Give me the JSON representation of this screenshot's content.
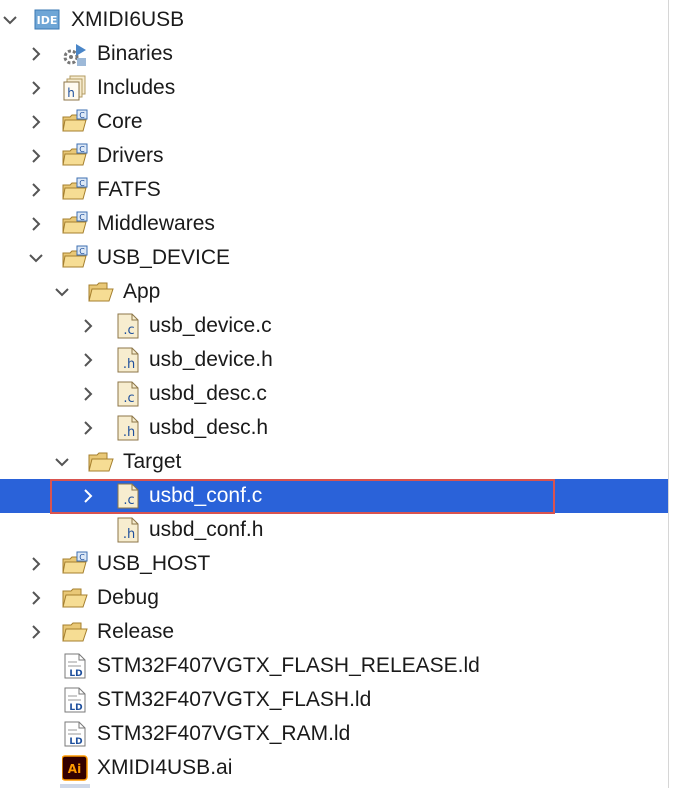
{
  "tree": {
    "rows": [
      {
        "label": "XMIDI6USB",
        "icon": "ide-project-icon",
        "chevron": "down"
      },
      {
        "label": "Binaries",
        "icon": "binaries-icon",
        "chevron": "right"
      },
      {
        "label": "Includes",
        "icon": "includes-icon",
        "chevron": "right"
      },
      {
        "label": "Core",
        "icon": "source-folder-icon",
        "chevron": "right"
      },
      {
        "label": "Drivers",
        "icon": "source-folder-icon",
        "chevron": "right"
      },
      {
        "label": "FATFS",
        "icon": "source-folder-icon",
        "chevron": "right"
      },
      {
        "label": "Middlewares",
        "icon": "source-folder-icon",
        "chevron": "right"
      },
      {
        "label": "USB_DEVICE",
        "icon": "source-folder-icon",
        "chevron": "down"
      },
      {
        "label": "App",
        "icon": "folder-open-icon",
        "chevron": "down"
      },
      {
        "label": "usb_device.c",
        "icon": "c-file-icon",
        "chevron": "right"
      },
      {
        "label": "usb_device.h",
        "icon": "h-file-icon",
        "chevron": "right"
      },
      {
        "label": "usbd_desc.c",
        "icon": "c-file-icon",
        "chevron": "right"
      },
      {
        "label": "usbd_desc.h",
        "icon": "h-file-icon",
        "chevron": "right"
      },
      {
        "label": "Target",
        "icon": "folder-open-icon",
        "chevron": "down"
      },
      {
        "label": "usbd_conf.c",
        "icon": "c-file-icon",
        "chevron": "right",
        "selected": true
      },
      {
        "label": "usbd_conf.h",
        "icon": "h-file-icon",
        "chevron": "none"
      },
      {
        "label": "USB_HOST",
        "icon": "source-folder-icon",
        "chevron": "right"
      },
      {
        "label": "Debug",
        "icon": "folder-open-icon",
        "chevron": "right"
      },
      {
        "label": "Release",
        "icon": "folder-open-icon",
        "chevron": "right"
      },
      {
        "label": "STM32F407VGTX_FLASH_RELEASE.ld",
        "icon": "ld-file-icon",
        "chevron": "none"
      },
      {
        "label": "STM32F407VGTX_FLASH.ld",
        "icon": "ld-file-icon",
        "chevron": "none"
      },
      {
        "label": "STM32F407VGTX_RAM.ld",
        "icon": "ld-file-icon",
        "chevron": "none"
      },
      {
        "label": "XMIDI4USB.ai",
        "icon": "illustrator-file-icon",
        "chevron": "none"
      }
    ]
  },
  "colors": {
    "selection": "#2a62d9",
    "highlight_border": "#d9534f",
    "chevron": "#555555"
  }
}
